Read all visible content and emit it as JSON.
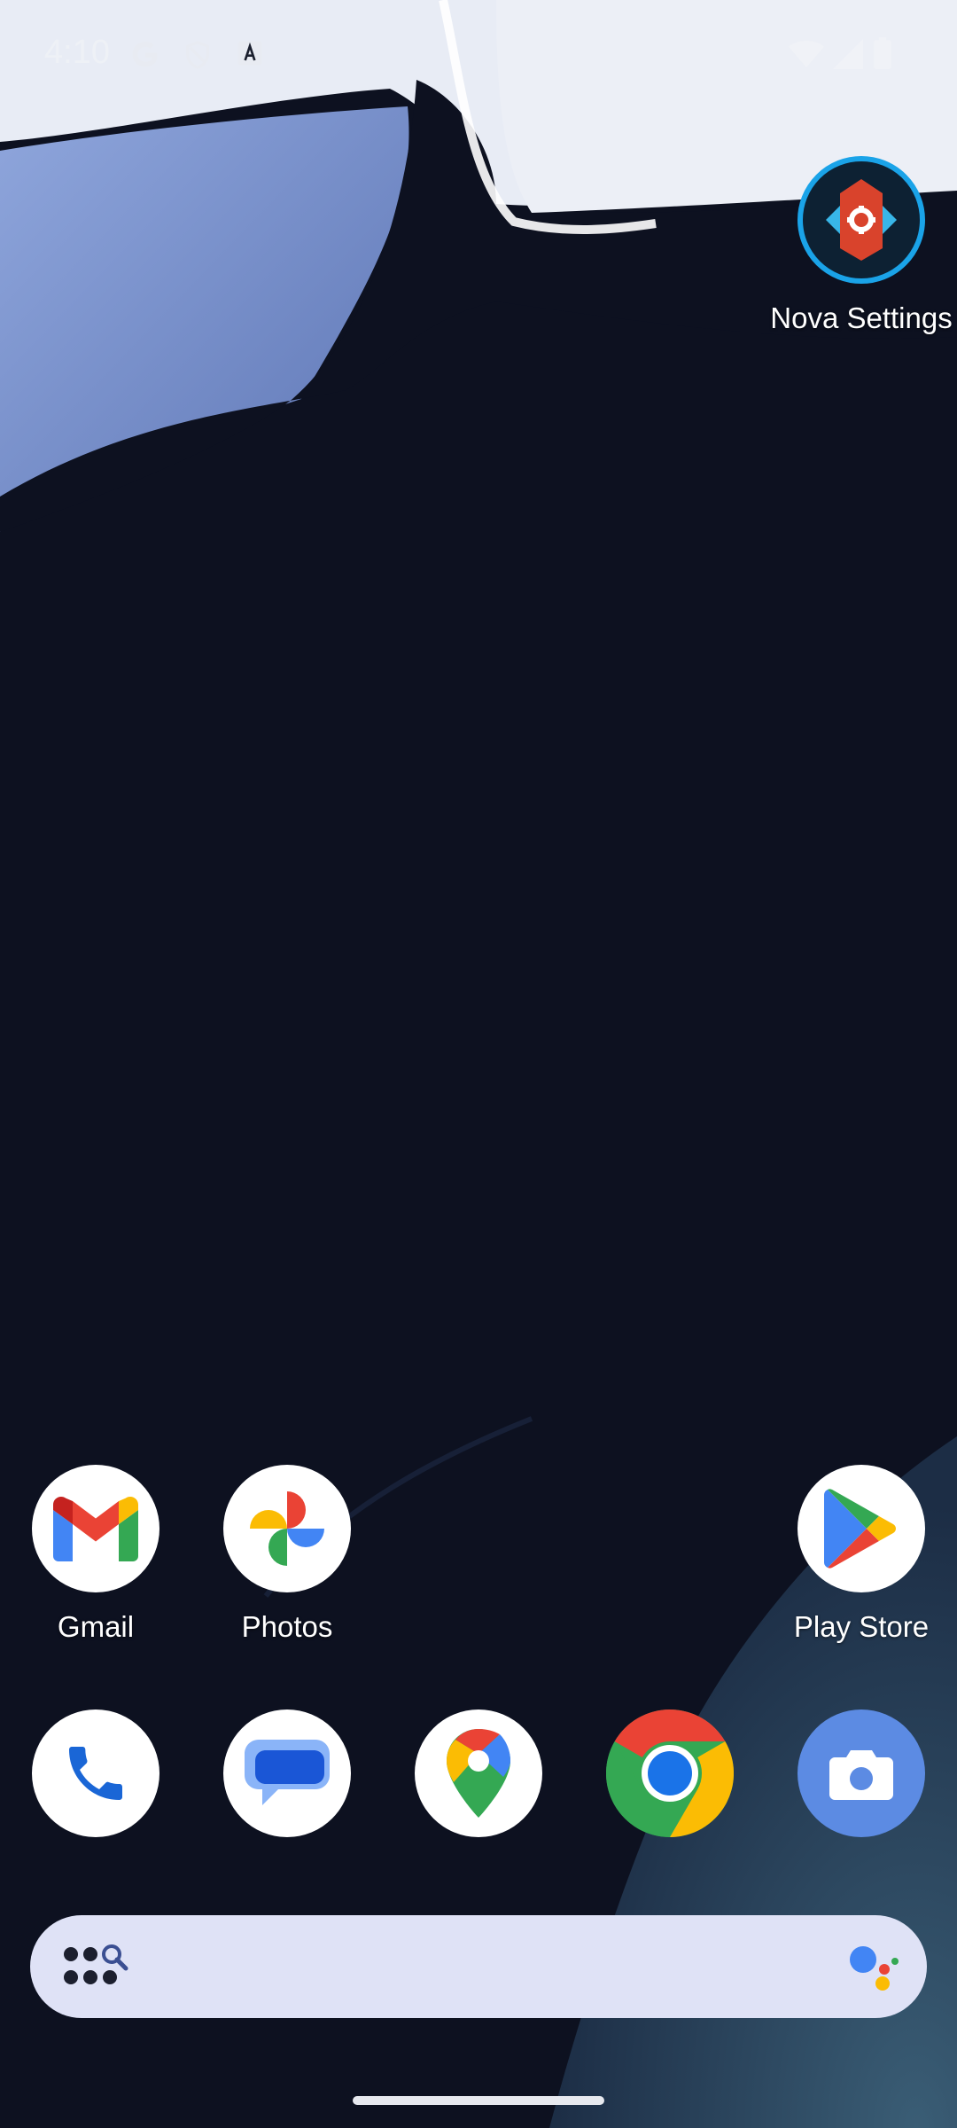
{
  "status_bar": {
    "time": "4:10",
    "left_icons": [
      "google-g-icon",
      "shield-icon",
      "font-a-icon"
    ],
    "right_icons": [
      "wifi-icon",
      "cell-signal-icon",
      "battery-icon"
    ]
  },
  "workspace": {
    "nova_settings": {
      "label": "Nova Settings",
      "icon": "nova-settings-icon"
    }
  },
  "home_row": [
    {
      "label": "Gmail",
      "icon": "gmail-icon"
    },
    {
      "label": "Photos",
      "icon": "photos-icon"
    },
    {
      "label": "Play Store",
      "icon": "play-store-icon"
    }
  ],
  "dock": [
    {
      "name": "Phone",
      "icon": "phone-icon"
    },
    {
      "name": "Messages",
      "icon": "messages-icon"
    },
    {
      "name": "Maps",
      "icon": "maps-icon"
    },
    {
      "name": "Chrome",
      "icon": "chrome-icon"
    },
    {
      "name": "Camera",
      "icon": "camera-icon"
    }
  ],
  "search_bar": {
    "left_icon": "app-drawer-search-icon",
    "right_icon": "google-assistant-icon"
  },
  "colors": {
    "wallpaper_dark": "#0d1120",
    "wallpaper_light": "#e9edf6",
    "search_bar_bg": "#dfe2f6",
    "nova_ring": "#1aa3e8"
  }
}
